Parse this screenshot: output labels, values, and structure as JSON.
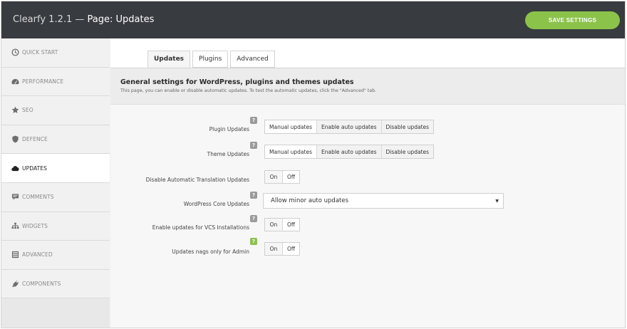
{
  "header": {
    "app_version": "Clearfy 1.2.1 —",
    "page_title": "Page: Updates",
    "save_label": "SAVE SETTINGS"
  },
  "sidebar": {
    "items": [
      {
        "label": "QUICK START",
        "icon": "clock-icon"
      },
      {
        "label": "PERFORMANCE",
        "icon": "dashboard-icon"
      },
      {
        "label": "SEO",
        "icon": "star-icon"
      },
      {
        "label": "DEFENCE",
        "icon": "shield-icon"
      },
      {
        "label": "UPDATES",
        "icon": "cloud-icon",
        "active": true
      },
      {
        "label": "COMMENTS",
        "icon": "comment-icon"
      },
      {
        "label": "WIDGETS",
        "icon": "sitemap-icon"
      },
      {
        "label": "ADVANCED",
        "icon": "list-icon"
      },
      {
        "label": "COMPONENTS",
        "icon": "plug-icon"
      }
    ]
  },
  "tabs": [
    {
      "label": "Updates",
      "active": true
    },
    {
      "label": "Plugins"
    },
    {
      "label": "Advanced"
    }
  ],
  "panel": {
    "title": "General settings for WordPress, plugins and themes updates",
    "description": "This page, you can enable or disable automatic updates. To test the automatic updates, click the \"Advanced\" tab."
  },
  "settings": {
    "plugin_updates": {
      "label": "Plugin Updates",
      "options": [
        "Manual updates",
        "Enable auto updates",
        "Disable updates"
      ],
      "selected": "Manual updates"
    },
    "theme_updates": {
      "label": "Theme Updates",
      "options": [
        "Manual updates",
        "Enable auto updates",
        "Disable updates"
      ],
      "selected": "Manual updates"
    },
    "translation_updates": {
      "label": "Disable Automatic Translation Updates",
      "on": "On",
      "off": "Off"
    },
    "core_updates": {
      "label": "WordPress Core Updates",
      "value": "Allow minor auto updates"
    },
    "vcs_updates": {
      "label": "Enable updates for VCS Installations",
      "on": "On",
      "off": "Off"
    },
    "nags_admin": {
      "label": "Updates nags only for Admin",
      "on": "On",
      "off": "Off"
    },
    "help_glyph": "?"
  },
  "colors": {
    "header_bg": "#383b3f",
    "accent": "#8bc34a"
  }
}
